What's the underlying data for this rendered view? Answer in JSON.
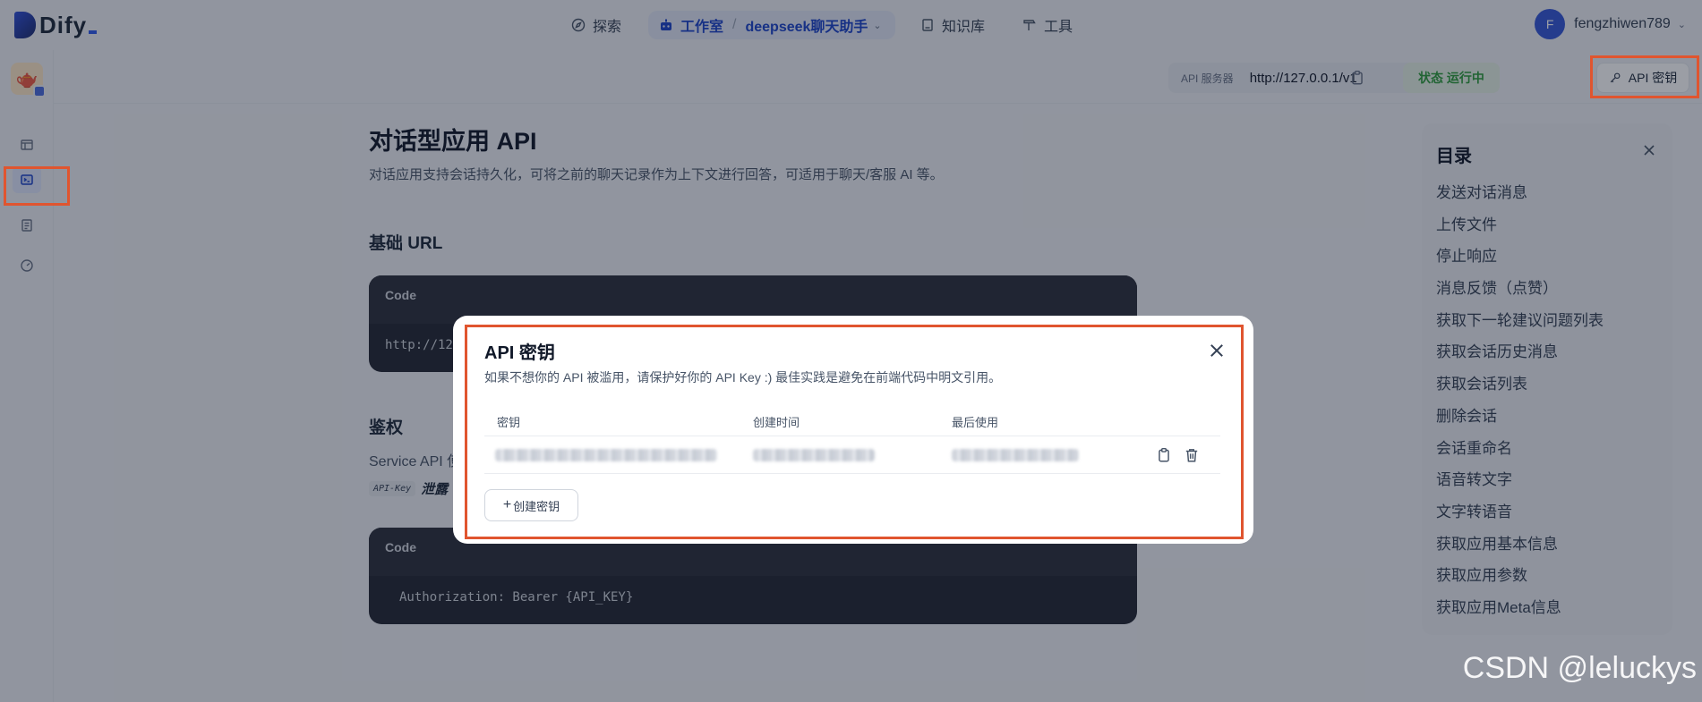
{
  "nav": {
    "logo_text": "Dify",
    "explore": "探索",
    "workspace": "工作室",
    "app_name": "deepseek聊天助手",
    "knowledge": "知识库",
    "tools": "工具",
    "user_initial": "F",
    "username": "fengzhiwen789"
  },
  "subbar": {
    "api_server_label": "API 服务器",
    "api_server_url": "http://127.0.0.1/v1",
    "status": "状态 运行中",
    "api_key_button": "API 密钥"
  },
  "main": {
    "title": "对话型应用 API",
    "description": "对话应用支持会话持久化，可将之前的聊天记录作为上下文进行回答，可适用于聊天/客服 AI 等。",
    "base_url_heading": "基础 URL",
    "code1_label": "Code",
    "code1_text": "http://127",
    "auth_heading": "鉴权",
    "auth_text": "Service API 使",
    "auth_tag": "API-Key",
    "auth_tag_after": "泄露",
    "code2_label": "Code",
    "code2_text": "Authorization: Bearer {API_KEY}"
  },
  "toc": {
    "title": "目录",
    "items": [
      "发送对话消息",
      "上传文件",
      "停止响应",
      "消息反馈（点赞）",
      "获取下一轮建议问题列表",
      "获取会话历史消息",
      "获取会话列表",
      "删除会话",
      "会话重命名",
      "语音转文字",
      "文字转语音",
      "获取应用基本信息",
      "获取应用参数",
      "获取应用Meta信息"
    ]
  },
  "modal": {
    "title": "API 密钥",
    "description": "如果不想你的 API 被滥用，请保护好你的 API Key :) 最佳实践是避免在前端代码中明文引用。",
    "columns": [
      "密钥",
      "创建时间",
      "最后使用"
    ],
    "create_button": "创建密钥"
  },
  "watermark": "CSDN @leluckys",
  "colors": {
    "highlight": "#e0552f",
    "accent": "#1d44c9",
    "status_green": "#2e9b3c"
  }
}
